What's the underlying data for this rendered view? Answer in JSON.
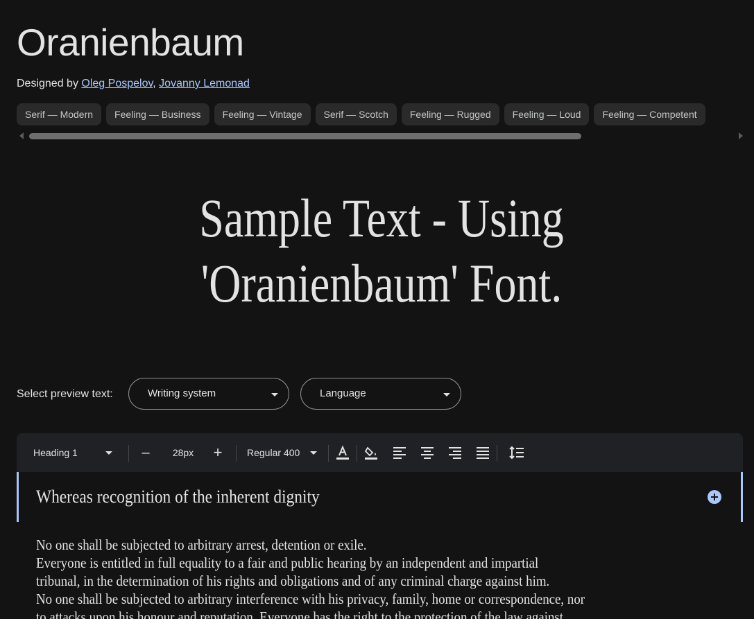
{
  "font": {
    "name": "Oranienbaum",
    "designed_by_label": "Designed by",
    "designers": [
      "Oleg Pospelov",
      "Jovanny Lemonad"
    ],
    "designer_separator": ", "
  },
  "tags": [
    "Serif — Modern",
    "Feeling — Business",
    "Feeling — Vintage",
    "Serif — Scotch",
    "Feeling — Rugged",
    "Feeling — Loud",
    "Feeling — Competent"
  ],
  "preview": {
    "sample_line1": "Sample Text - Using",
    "sample_line2": "'Oranienbaum' Font."
  },
  "preview_select": {
    "label": "Select preview text:",
    "writing_system": "Writing system",
    "language": "Language"
  },
  "toolbar": {
    "style": "Heading 1",
    "decrease_label": "–",
    "size": "28px",
    "increase_label": "+",
    "weight": "Regular 400",
    "icons": [
      "text-color-icon",
      "fill-color-icon",
      "align-left-icon",
      "align-center-icon",
      "align-right-icon",
      "align-justify-icon",
      "line-height-icon"
    ]
  },
  "editor": {
    "heading": "Whereas recognition of the inherent dignity",
    "body_lines": [
      "No one shall be subjected to arbitrary arrest, detention or exile.",
      "Everyone is entitled in full equality to a fair and public hearing by an independent and impartial",
      "tribunal, in the determination of his rights and obligations and of any criminal charge against him.",
      "No one shall be subjected to arbitrary interference with his privacy, family, home or correspondence, nor",
      "to attacks upon his honour and reputation. Everyone has the right to the protection of the law against"
    ]
  },
  "colors": {
    "background": "#131314",
    "text": "#e3e3e3",
    "accent": "#a8c7fa",
    "chip": "#2a2a2b"
  }
}
